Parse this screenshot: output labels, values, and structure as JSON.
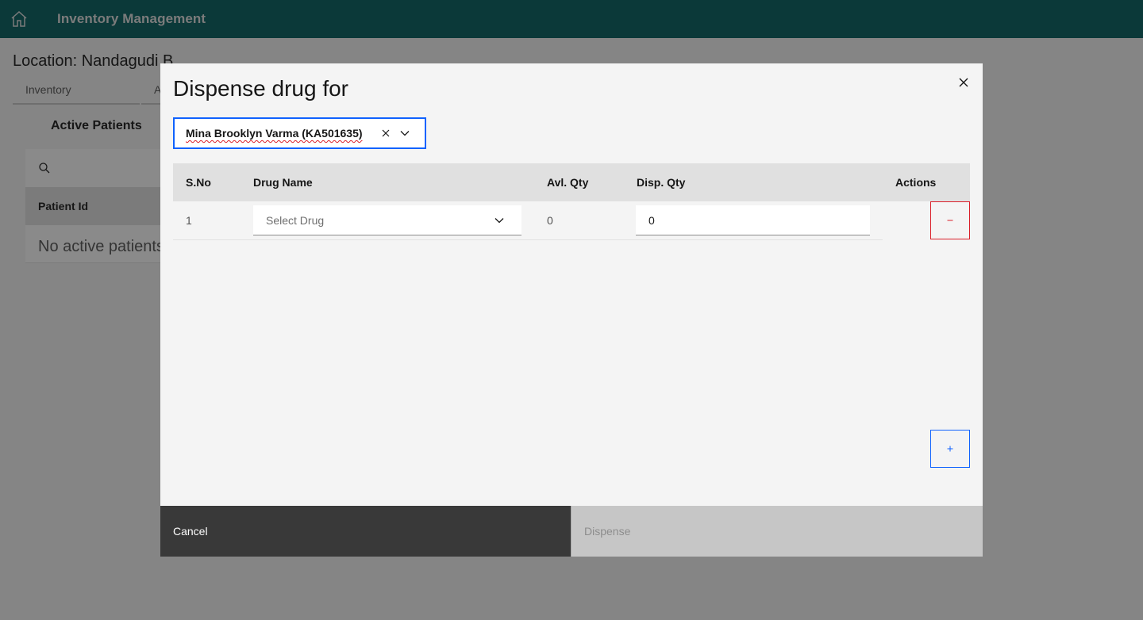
{
  "app": {
    "title": "Inventory Management",
    "location": "Location: Nandagudi B",
    "tabs": [
      {
        "label": "Inventory"
      },
      {
        "label": "A"
      }
    ],
    "panel_title": "Active Patients",
    "patient_table": {
      "header": "Patient Id",
      "empty_message": "No active patients"
    }
  },
  "modal": {
    "title": "Dispense drug for",
    "patient": {
      "selected": "Mina Brooklyn Varma (KA501635)"
    },
    "table": {
      "headers": {
        "sno": "S.No",
        "drug_name": "Drug Name",
        "avl_qty": "Avl. Qty",
        "disp_qty": "Disp. Qty",
        "actions": "Actions"
      },
      "rows": [
        {
          "sno": "1",
          "drug_placeholder": "Select Drug",
          "avl_qty": "0",
          "disp_qty": "0"
        }
      ]
    },
    "buttons": {
      "cancel": "Cancel",
      "dispense": "Dispense"
    }
  },
  "colors": {
    "header_bg": "#005d5d",
    "primary": "#0f62fe",
    "danger": "#da1e28",
    "secondary_btn": "#393939",
    "disabled_btn": "#c6c6c6"
  },
  "icons": {
    "home": "home-icon",
    "search": "search-icon",
    "close": "close-icon",
    "clear": "clear-icon",
    "chevron": "chevron-down-icon",
    "subtract": "subtract-icon",
    "add": "add-icon"
  }
}
